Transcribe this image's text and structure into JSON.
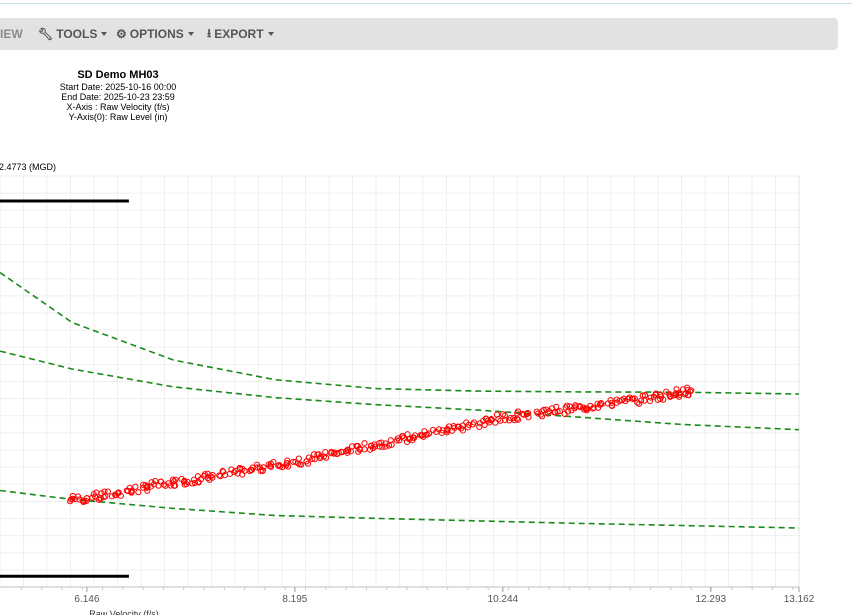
{
  "toolbar": {
    "view_label": "IEW",
    "tools_label": "TOOLS",
    "options_label": "OPTIONS",
    "export_label": "EXPORT"
  },
  "header": {
    "title": "SD Demo MH03",
    "start_date": "Start Date: 2025-10-16 00:00",
    "end_date": "End Date: 2025-10-23 23:59",
    "x_axis_desc": "X-Axis : Raw Velocity (f/s)",
    "y_axis_desc": "Y-Axis(0): Raw Level (in)"
  },
  "flow_label": "2.4773 (MGD)",
  "colors": {
    "scatter": "#ff0000",
    "iso_curve": "#1a8a1a",
    "limit_line": "#000000",
    "toolbar_bg": "#e1e2e3"
  },
  "chart_data": {
    "type": "scatter",
    "xlabel": "Raw Velocity (f/s)",
    "ylabel": "",
    "x_ticks": [
      "6.146",
      "8.195",
      "10.244",
      "12.293",
      "13.162"
    ],
    "xlim": [
      5.29,
      13.162
    ],
    "grid": true,
    "series": [
      {
        "kind": "scatter",
        "points": [
          [
            5.99,
            7.45
          ],
          [
            6.2,
            7.5
          ],
          [
            6.45,
            7.62
          ],
          [
            6.7,
            7.78
          ],
          [
            6.95,
            7.9
          ],
          [
            7.2,
            8.0
          ],
          [
            7.45,
            8.12
          ],
          [
            7.7,
            8.25
          ],
          [
            7.95,
            8.38
          ],
          [
            8.2,
            8.5
          ],
          [
            8.45,
            8.65
          ],
          [
            8.7,
            8.8
          ],
          [
            8.95,
            8.95
          ],
          [
            9.2,
            9.1
          ],
          [
            9.45,
            9.25
          ],
          [
            9.7,
            9.4
          ],
          [
            9.95,
            9.55
          ],
          [
            10.2,
            9.7
          ],
          [
            10.45,
            9.82
          ],
          [
            10.7,
            9.92
          ],
          [
            10.95,
            10.0
          ],
          [
            11.2,
            10.1
          ],
          [
            11.45,
            10.2
          ],
          [
            11.7,
            10.3
          ],
          [
            11.95,
            10.42
          ],
          [
            12.1,
            10.5
          ]
        ]
      },
      {
        "kind": "iso-flow",
        "points": [
          [
            5.29,
            13.8
          ],
          [
            6.0,
            12.4
          ],
          [
            7.0,
            11.35
          ],
          [
            8.0,
            10.8
          ],
          [
            9.0,
            10.55
          ],
          [
            10.0,
            10.48
          ],
          [
            11.0,
            10.46
          ],
          [
            12.0,
            10.45
          ],
          [
            13.162,
            10.4
          ]
        ]
      },
      {
        "kind": "iso-flow",
        "points": [
          [
            5.29,
            11.6
          ],
          [
            6.0,
            11.1
          ],
          [
            7.0,
            10.6
          ],
          [
            8.0,
            10.3
          ],
          [
            9.0,
            10.1
          ],
          [
            10.0,
            9.95
          ],
          [
            11.0,
            9.75
          ],
          [
            12.0,
            9.55
          ],
          [
            13.162,
            9.4
          ]
        ]
      },
      {
        "kind": "iso-flow",
        "points": [
          [
            5.29,
            7.7
          ],
          [
            6.0,
            7.45
          ],
          [
            7.0,
            7.2
          ],
          [
            8.0,
            7.0
          ],
          [
            9.0,
            6.92
          ],
          [
            10.0,
            6.85
          ],
          [
            11.0,
            6.78
          ],
          [
            12.0,
            6.72
          ],
          [
            13.162,
            6.65
          ]
        ]
      }
    ],
    "limit_lines": [
      {
        "x_start": 5.29,
        "x_end": 6.56,
        "y": 15.8
      },
      {
        "x_start": 5.29,
        "x_end": 6.56,
        "y": 5.3
      }
    ]
  }
}
